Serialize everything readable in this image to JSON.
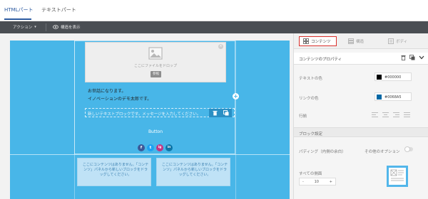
{
  "top_tabs": [
    {
      "label": "HTMLパート",
      "active": true
    },
    {
      "label": "テキストパート",
      "active": false
    }
  ],
  "toolbar": {
    "action_label": "アクション",
    "structure_label": "構造を表示"
  },
  "canvas": {
    "drop_text": "ここにファイルをドロップ",
    "drop_button": "参照",
    "greeting_line1": "お世話になります。",
    "greeting_line2": "イノベーションのデモ太郎です。",
    "new_block_text": "新しいテキストブロックです。メッセージを入力してください。",
    "button_label": "Button",
    "social": [
      "f",
      "t",
      "ig",
      "in"
    ],
    "empty_column_text": "ここにコンテンツはありません。「コンテンツ」パネルから新しいブロックをドラッグしてください。"
  },
  "panel": {
    "tabs": [
      {
        "label": "コンテンツ",
        "icon": "grid-icon",
        "active": true
      },
      {
        "label": "構造",
        "icon": "rows-icon",
        "active": false
      },
      {
        "label": "ボディ",
        "icon": "body-icon",
        "active": false
      }
    ],
    "section_title": "コンテンツのプロパティ",
    "text_color_label": "テキストの色",
    "text_color_value": "#000000",
    "link_color_label": "リンクの色",
    "link_color_value": "#0068A5",
    "line_label": "行揃",
    "block_settings_label": "ブロック設定",
    "padding_label": "パディング（内側の余白）",
    "options_label": "その他のオプション",
    "all_sides_label": "すべての側面",
    "padding_value": "10",
    "stepper_minus": "-",
    "stepper_plus": "+"
  },
  "colors": {
    "canvas_bg": "#48b6e8",
    "accent_blue": "#2c5aa0",
    "active_tab_border": "#d9302c",
    "facebook": "#3b5998",
    "twitter": "#1da1f2",
    "instagram": "#c13584",
    "linkedin": "#0e76a8"
  }
}
